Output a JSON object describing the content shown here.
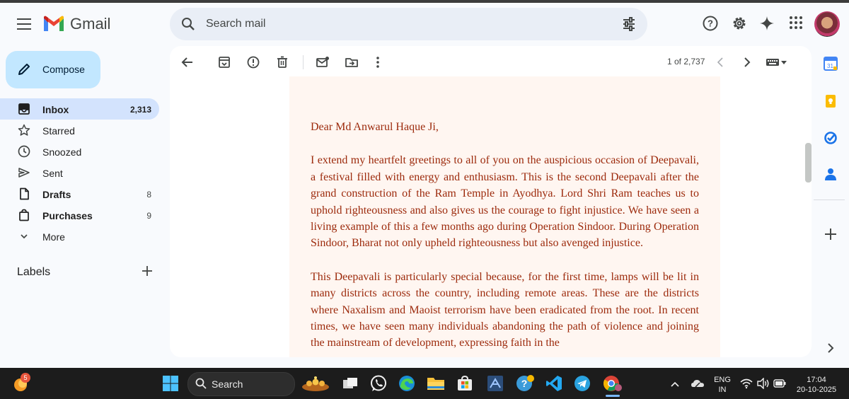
{
  "header": {
    "app_name": "Gmail",
    "search_placeholder": "Search mail"
  },
  "compose_label": "Compose",
  "nav": [
    {
      "label": "Inbox",
      "count": "2,313",
      "icon": "inbox-icon",
      "active": true
    },
    {
      "label": "Starred",
      "count": "",
      "icon": "star-icon"
    },
    {
      "label": "Snoozed",
      "count": "",
      "icon": "clock-icon"
    },
    {
      "label": "Sent",
      "count": "",
      "icon": "send-icon"
    },
    {
      "label": "Drafts",
      "count": "8",
      "icon": "draft-icon"
    },
    {
      "label": "Purchases",
      "count": "9",
      "icon": "purchases-icon"
    },
    {
      "label": "More",
      "count": "",
      "icon": "chevron-down-icon"
    }
  ],
  "labels_title": "Labels",
  "pager": "1 of 2,737",
  "email": {
    "greeting": "Dear Md Anwarul Haque Ji,",
    "paragraphs": [
      "I extend my heartfelt greetings to all of you on the auspicious occasion of Deepavali, a festival filled with energy and enthusiasm. This is the second Deepavali after the grand construction of the Ram Temple in Ayodhya. Lord Shri Ram teaches us to uphold righteousness and also gives us the courage to fight injustice. We have seen a living example of this a few months ago during Operation Sindoor. During Operation Sindoor, Bharat not only upheld righteousness but also avenged injustice.",
      "This Deepavali is particularly special because, for the first time, lamps will be lit in many districts across the country, including remote areas. These are the districts where Naxalism and Maoist terrorism have been eradicated from the root. In recent times, we have seen many individuals abandoning the path of violence and joining the mainstream of development, expressing faith in the"
    ]
  },
  "taskbar": {
    "notification_badge": "5",
    "search_label": "Search",
    "language_line1": "ENG",
    "language_line2": "IN",
    "time": "17:04",
    "date": "20-10-2025"
  },
  "colors": {
    "accent": "#c2e7ff",
    "nav_active": "#d3e3fd",
    "letter_bg": "#fff6f1",
    "letter_text": "#9c2a0c"
  }
}
